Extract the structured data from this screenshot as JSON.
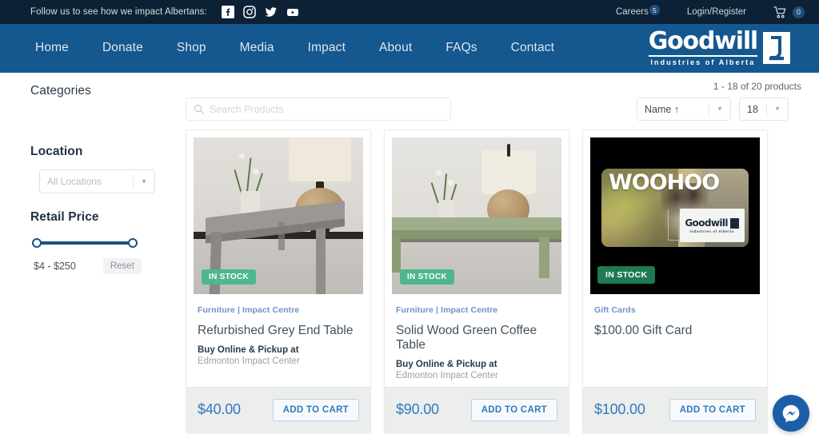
{
  "topbar": {
    "follow_text": "Follow us to see how we impact Albertans:",
    "social": [
      {
        "name": "facebook-icon",
        "label": "Facebook"
      },
      {
        "name": "instagram-icon",
        "label": "Instagram"
      },
      {
        "name": "twitter-icon",
        "label": "Twitter"
      },
      {
        "name": "youtube-icon",
        "label": "YouTube"
      }
    ],
    "careers_label": "Careers",
    "careers_badge": "5",
    "login_label": "Login/Register",
    "cart_count": "0"
  },
  "nav": {
    "items": [
      {
        "label": "Home"
      },
      {
        "label": "Donate"
      },
      {
        "label": "Shop"
      },
      {
        "label": "Media"
      },
      {
        "label": "Impact"
      },
      {
        "label": "About"
      },
      {
        "label": "FAQs"
      },
      {
        "label": "Contact"
      }
    ],
    "logo_word": "Goodwill",
    "logo_sub": "Industries of Alberta"
  },
  "sidebar": {
    "categories_heading": "Categories",
    "location_heading": "Location",
    "location_value": "All Locations",
    "price_heading": "Retail Price",
    "price_range": "$4 - $250",
    "reset_label": "Reset"
  },
  "toolbar": {
    "search_placeholder": "Search Products",
    "search_value": "",
    "results_count": "1 - 18 of 20 products",
    "sort_value": "Name ↑",
    "per_page_value": "18"
  },
  "products": [
    {
      "category": "Furniture | Impact Centre",
      "title": "Refurbished Grey End Table",
      "pickup_label": "Buy Online & Pickup at",
      "pickup_place": "Edmonton Impact Center",
      "price": "$40.00",
      "stock_badge": "IN STOCK",
      "add_label": "ADD TO CART",
      "image_kind": "grey-end-table-photo"
    },
    {
      "category": "Furniture | Impact Centre",
      "title": "Solid Wood Green Coffee Table",
      "pickup_label": "Buy Online & Pickup at",
      "pickup_place": "Edmonton Impact Center",
      "price": "$90.00",
      "stock_badge": "IN STOCK",
      "add_label": "ADD TO CART",
      "image_kind": "green-coffee-table-photo"
    },
    {
      "category": "Gift Cards",
      "title": "$100.00 Gift Card",
      "pickup_label": "",
      "pickup_place": "",
      "price": "$100.00",
      "stock_badge": "IN STOCK",
      "add_label": "ADD TO CART",
      "image_kind": "gift-card-photo",
      "gift_card_text": "WOOHOO",
      "gift_card_brand": "Goodwill",
      "gift_card_brand_sub": "Industries of Alberta"
    }
  ],
  "chat": {
    "widget_name": "messenger-chat-button"
  },
  "colors": {
    "topbar_bg": "#0d2136",
    "nav_bg": "#15578f",
    "accent_blue": "#2f7bbf",
    "stock_green": "#4db88c",
    "stock_green_dark": "#1e7a50",
    "slider_blue": "#1b5180"
  }
}
